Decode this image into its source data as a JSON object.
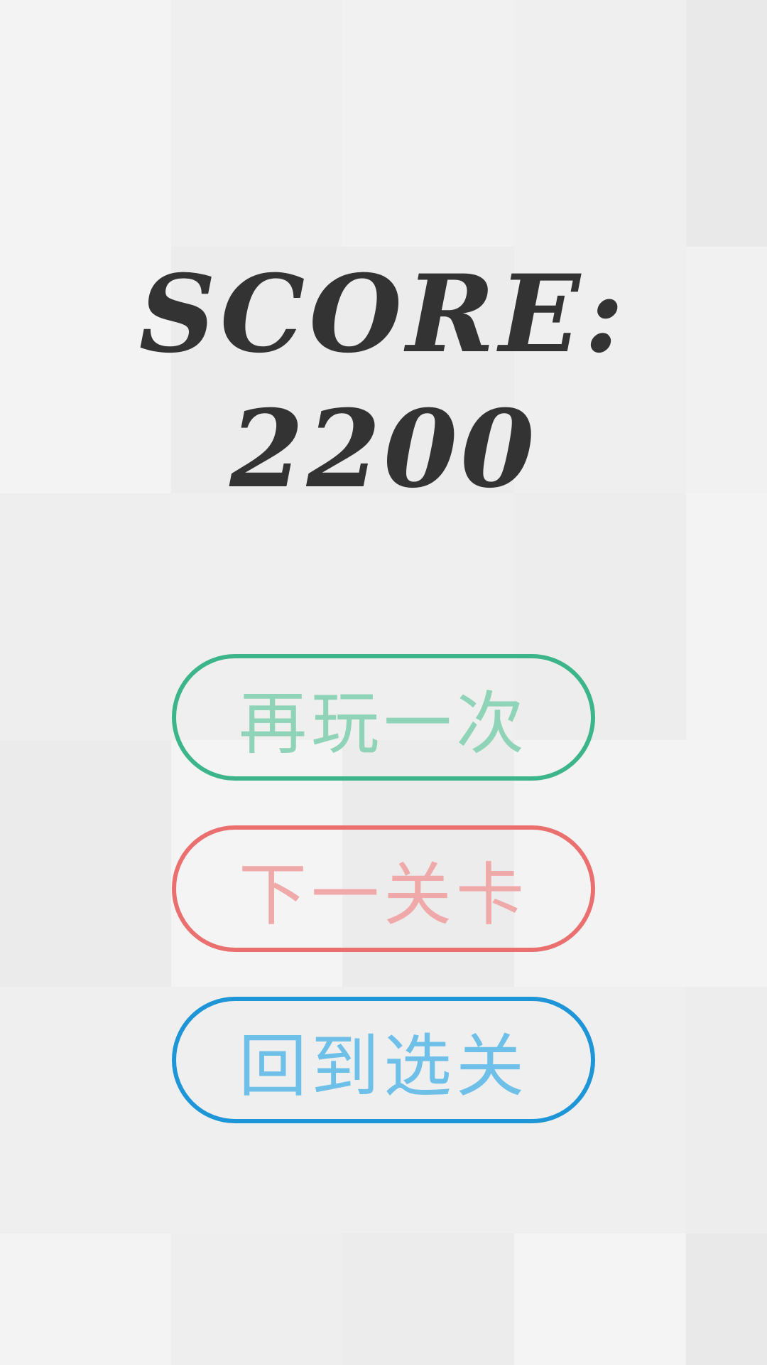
{
  "score": {
    "label": "SCORE:",
    "value": "2200"
  },
  "buttons": {
    "replay": "再玩一次",
    "next_level": "下一关卡",
    "level_select": "回到选关"
  },
  "colors": {
    "background": "#efefef",
    "text": "#333333",
    "replay_border": "#3db58a",
    "next_border": "#ea7070",
    "select_border": "#1e95d6"
  }
}
